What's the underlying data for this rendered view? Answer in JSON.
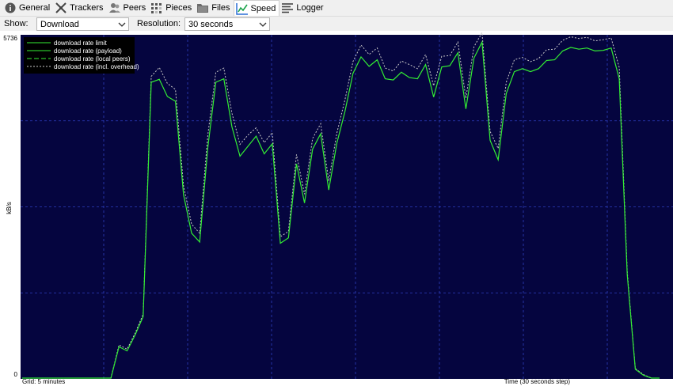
{
  "tabs": [
    {
      "label": "General",
      "icon": "info-icon"
    },
    {
      "label": "Trackers",
      "icon": "trackers-icon"
    },
    {
      "label": "Peers",
      "icon": "peers-icon"
    },
    {
      "label": "Pieces",
      "icon": "pieces-icon"
    },
    {
      "label": "Files",
      "icon": "folder-icon"
    },
    {
      "label": "Speed",
      "icon": "speed-chart-icon",
      "active": true
    },
    {
      "label": "Logger",
      "icon": "logger-icon"
    }
  ],
  "options": {
    "show_label": "Show:",
    "show_value": "Download",
    "resolution_label": "Resolution:",
    "resolution_value": "30 seconds"
  },
  "colors": {
    "plot_bg": "#05053f",
    "grid": "#2e3fbf",
    "series": "#33ee33",
    "overhead": "#c8c8c8",
    "axis_text": "#ffffff"
  },
  "chart_data": {
    "type": "line",
    "ylabel": "kB/s",
    "ylim": [
      0,
      5736
    ],
    "yticks": [
      "5736",
      "0"
    ],
    "grid_label": "Grid: 5 minutes",
    "time_label": "Time (30 seconds step)",
    "legend_placement": "top-left",
    "legend": [
      {
        "name": "download rate limit",
        "style": "solid"
      },
      {
        "name": "download rate (payload)",
        "style": "solid"
      },
      {
        "name": "download rate (local peers)",
        "style": "dashed"
      },
      {
        "name": "download rate (incl. overhead)",
        "style": "dotted"
      }
    ],
    "x": [
      0,
      1,
      2,
      3,
      4,
      5,
      6,
      7,
      8,
      9,
      10,
      11,
      12,
      13,
      14,
      15,
      16,
      17,
      18,
      19,
      20,
      21,
      22,
      23,
      24,
      25,
      26,
      27,
      28,
      29,
      30,
      31,
      32,
      33,
      34,
      35,
      36,
      37,
      38,
      39,
      40,
      41,
      42,
      43,
      44,
      45,
      46,
      47,
      48,
      49,
      50,
      51,
      52,
      53,
      54,
      55,
      56,
      57,
      58,
      59,
      60,
      61,
      62,
      63,
      64,
      65,
      66,
      67,
      68,
      69,
      70,
      71,
      72,
      73,
      74,
      75,
      76,
      77,
      78,
      79
    ],
    "series": [
      {
        "name": "download rate (payload)",
        "values": [
          0,
          0,
          0,
          0,
          0,
          0,
          0,
          0,
          0,
          0,
          0,
          0,
          530,
          460,
          730,
          1040,
          5000,
          5050,
          4760,
          4680,
          3100,
          2450,
          2300,
          3890,
          5000,
          5060,
          4250,
          3750,
          3920,
          4090,
          3790,
          3960,
          2280,
          2370,
          3620,
          2960,
          3870,
          4130,
          3180,
          3970,
          4500,
          5150,
          5430,
          5270,
          5380,
          5060,
          5040,
          5170,
          5080,
          5060,
          5300,
          4750,
          5260,
          5280,
          5500,
          4550,
          5410,
          5680,
          4020,
          3690,
          4810,
          5180,
          5230,
          5180,
          5230,
          5370,
          5380,
          5530,
          5590,
          5560,
          5580,
          5530,
          5540,
          5580,
          5060,
          1750,
          150,
          50,
          0,
          0
        ]
      },
      {
        "name": "download rate (incl. overhead)",
        "values": [
          0,
          0,
          0,
          0,
          0,
          0,
          0,
          0,
          0,
          0,
          0,
          0,
          560,
          490,
          760,
          1080,
          5100,
          5250,
          4980,
          4880,
          3250,
          2600,
          2450,
          4100,
          5170,
          5240,
          4480,
          3950,
          4110,
          4230,
          3980,
          4150,
          2390,
          2480,
          3780,
          3110,
          4050,
          4300,
          3330,
          4140,
          4700,
          5350,
          5630,
          5470,
          5580,
          5240,
          5190,
          5360,
          5300,
          5230,
          5470,
          4940,
          5440,
          5450,
          5680,
          4730,
          5600,
          5840,
          4170,
          3880,
          5000,
          5380,
          5420,
          5350,
          5400,
          5550,
          5560,
          5710,
          5770,
          5740,
          5760,
          5700,
          5720,
          5750,
          5250,
          1800,
          160,
          60,
          0,
          0
        ]
      }
    ]
  }
}
